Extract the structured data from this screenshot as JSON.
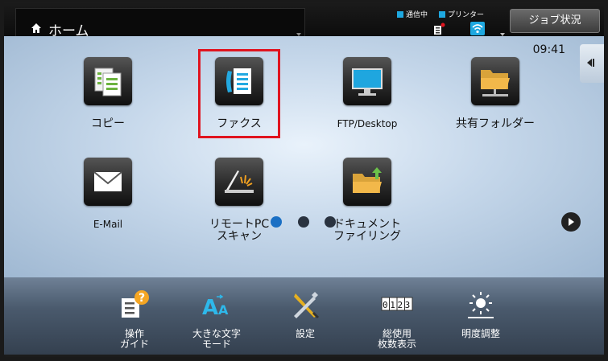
{
  "header": {
    "title": "ホーム",
    "status_comm": "通信中",
    "status_printer": "プリンター",
    "job_status_label": "ジョブ状況"
  },
  "main": {
    "time": "09:41",
    "apps": [
      {
        "label": "コピー"
      },
      {
        "label": "ファクス"
      },
      {
        "label": "FTP/Desktop"
      },
      {
        "label": "共有フォルダー"
      },
      {
        "label": "E-Mail"
      },
      {
        "label_line1": "リモートPC",
        "label_line2": "スキャン"
      },
      {
        "label_line1": "ドキュメント",
        "label_line2": "ファイリング"
      }
    ],
    "pager": {
      "pages": 3,
      "current": 1
    }
  },
  "toolbar": {
    "items": [
      {
        "line1": "操作",
        "line2": "ガイド"
      },
      {
        "line1": "大きな文字",
        "line2": "モード"
      },
      {
        "line1": "設定",
        "line2": ""
      },
      {
        "line1": "総使用",
        "line2": "枚数表示"
      },
      {
        "line1": "明度調整",
        "line2": ""
      }
    ],
    "counter_text": "0123"
  },
  "colors": {
    "accent": "#1ea8e0",
    "highlight": "#e0141f",
    "dot_active": "#1a6fc4",
    "dot_inactive": "#2a3340"
  }
}
